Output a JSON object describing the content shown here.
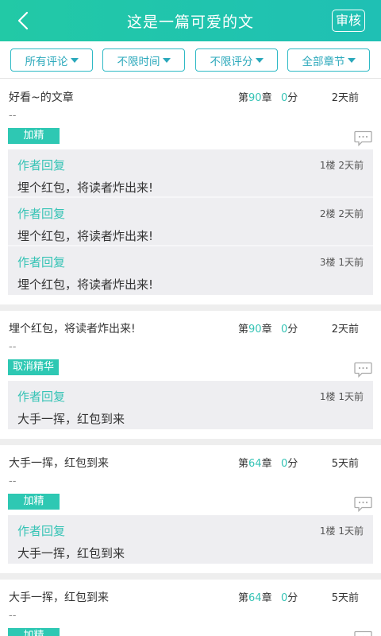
{
  "header": {
    "title": "这是一篇可爱的文",
    "audit_label": "审核"
  },
  "filters": [
    {
      "label": "所有评论"
    },
    {
      "label": "不限时间"
    },
    {
      "label": "不限评分"
    },
    {
      "label": "全部章节"
    }
  ],
  "comments": [
    {
      "text": "好看~的文章",
      "chapter_prefix": "第",
      "chapter": "90",
      "chapter_suffix": "章",
      "score": "0",
      "score_suffix": "分",
      "time": "2天前",
      "dash": "--",
      "tag": "加精",
      "replies": [
        {
          "label": "作者回复",
          "floor": "1楼 2天前",
          "text": "埋个红包，将读者炸出来!"
        },
        {
          "label": "作者回复",
          "floor": "2楼 2天前",
          "text": "埋个红包，将读者炸出来!"
        },
        {
          "label": "作者回复",
          "floor": "3楼 1天前",
          "text": "埋个红包，将读者炸出来!"
        }
      ]
    },
    {
      "text": "埋个红包，将读者炸出来!",
      "chapter_prefix": "第",
      "chapter": "90",
      "chapter_suffix": "章",
      "score": "0",
      "score_suffix": "分",
      "time": "2天前",
      "dash": "--",
      "tag": "取消精华",
      "replies": [
        {
          "label": "作者回复",
          "floor": "1楼 1天前",
          "text": "大手一挥，红包到来"
        }
      ]
    },
    {
      "text": "大手一挥，红包到来",
      "chapter_prefix": "第",
      "chapter": "64",
      "chapter_suffix": "章",
      "score": "0",
      "score_suffix": "分",
      "time": "5天前",
      "dash": "--",
      "tag": "加精",
      "replies": [
        {
          "label": "作者回复",
          "floor": "1楼 1天前",
          "text": "大手一挥，红包到来"
        }
      ]
    },
    {
      "text": "大手一挥，红包到来",
      "chapter_prefix": "第",
      "chapter": "64",
      "chapter_suffix": "章",
      "score": "0",
      "score_suffix": "分",
      "time": "5天前",
      "dash": "--",
      "tag": "加精",
      "replies": []
    }
  ],
  "colors": {
    "accent": "#2ec8b3",
    "header_start": "#22c9a6",
    "header_end": "#1fc0b4",
    "filter_border": "#2eb9c5"
  },
  "icons": {
    "back": "chevron-left-icon",
    "comment": "message-bubble-icon",
    "dropdown": "caret-down-icon"
  }
}
